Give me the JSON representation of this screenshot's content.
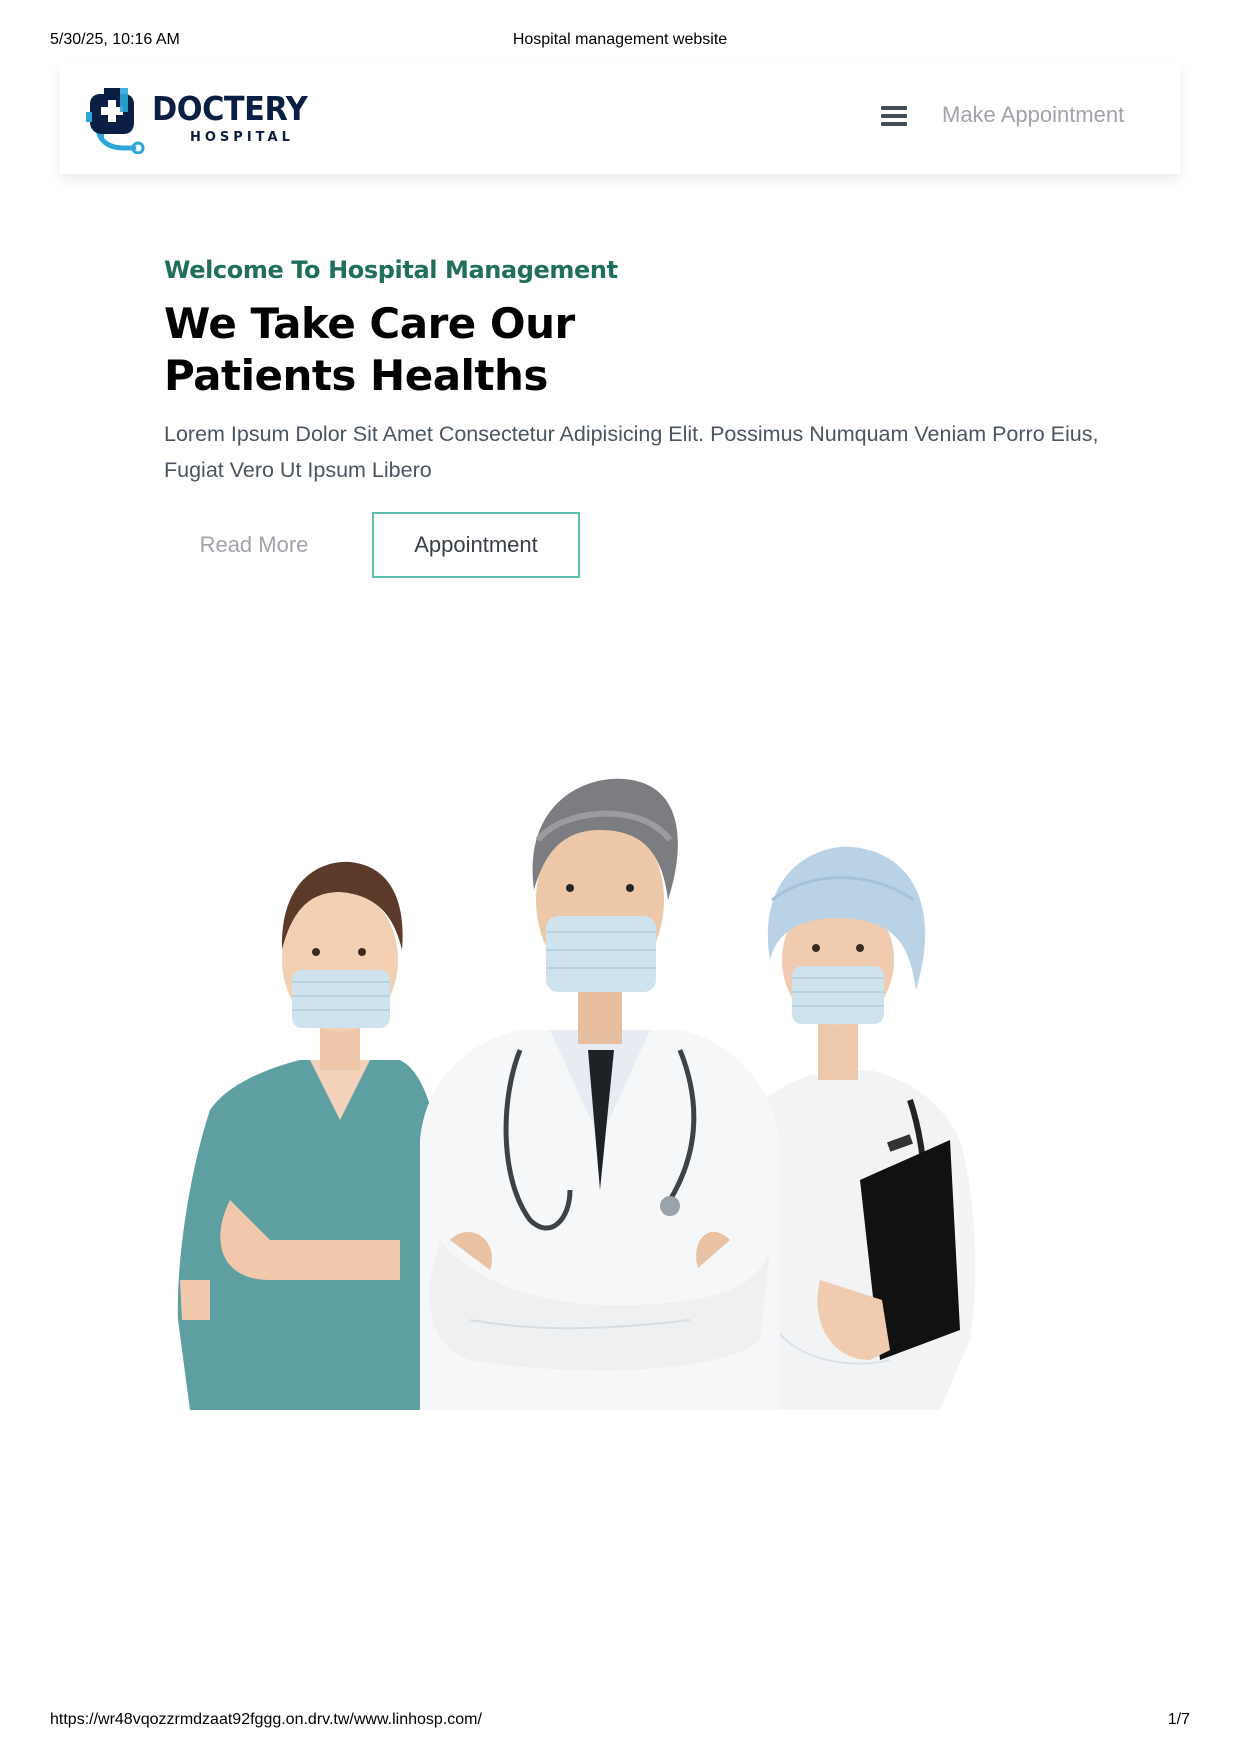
{
  "print": {
    "datetime": "5/30/25, 10:16 AM",
    "title": "Hospital management website",
    "url": "https://wr48vqozzrmdzaat92fggg.on.drv.tw/www.linhosp.com/",
    "page": "1/7"
  },
  "navbar": {
    "brand_name": "DOCTERY",
    "brand_sub": "HOSPITAL",
    "menu_icon": "hamburger-menu-icon",
    "make_appointment_label": "Make Appointment"
  },
  "hero": {
    "welcome": "Welcome To Hospital Management",
    "headline_line1": "We Take Care Our",
    "headline_line2": "Patients Healths",
    "lead": "Lorem Ipsum Dolor Sit Amet Consectetur Adipisicing Elit. Possimus Numquam Veniam Porro Eius, Fugiat Vero Ut Ipsum Libero",
    "read_more_label": "Read More",
    "appointment_label": "Appointment"
  },
  "colors": {
    "brand_navy": "#0b1f45",
    "brand_blue": "#2ea7d8",
    "accent_green": "#1f6f5c",
    "button_border": "#5cbfae"
  }
}
